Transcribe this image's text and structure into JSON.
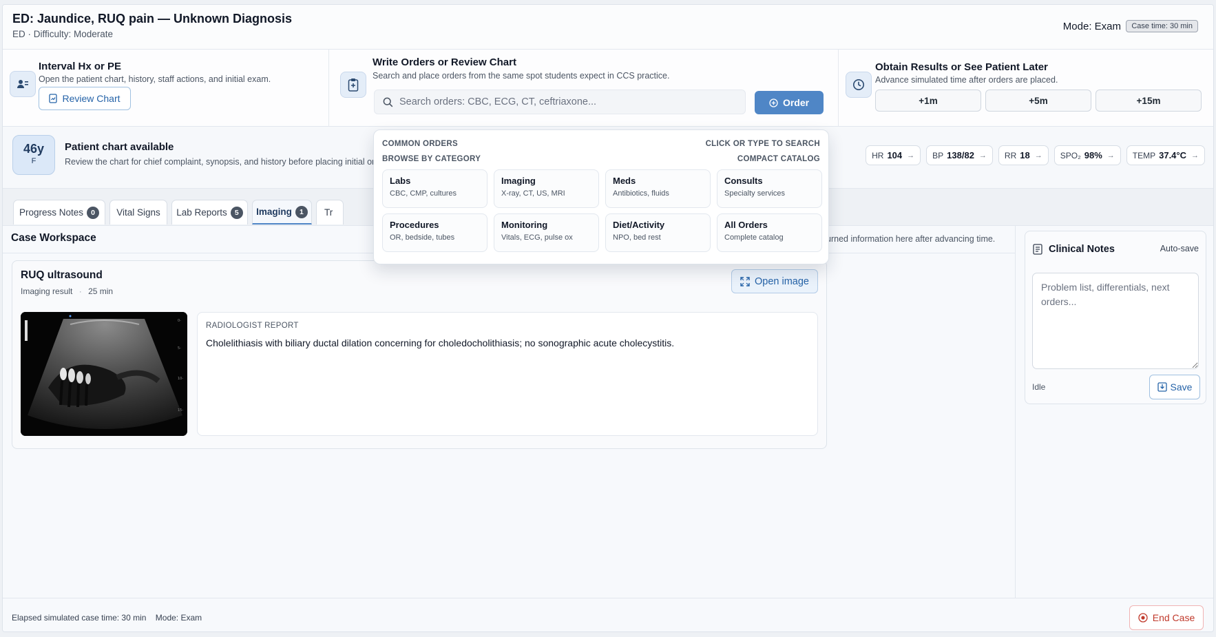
{
  "header": {
    "title": "ED: Jaundice, RUQ pain — Unknown Diagnosis",
    "subtitle": "ED · Difficulty: Moderate",
    "mode": "Mode: Exam",
    "case_time": "Case time: 30 min"
  },
  "actions": {
    "interval": {
      "title": "Interval Hx or PE",
      "desc": "Open the patient chart, history, staff actions, and initial exam.",
      "button": "Review Chart"
    },
    "orders": {
      "title": "Write Orders or Review Chart",
      "desc": "Search and place orders from the same spot students expect in CCS practice.",
      "search_placeholder": "Search orders: CBC, ECG, CT, ceftriaxone...",
      "button": "Order"
    },
    "results": {
      "title": "Obtain Results or See Patient Later",
      "desc": "Advance simulated time after orders are placed.",
      "buttons": [
        "+1m",
        "+5m",
        "+15m"
      ]
    }
  },
  "patient": {
    "age": "46y",
    "sex": "F",
    "title": "Patient chart available",
    "desc": "Review the chart for chief complaint, synopsis, and history before placing initial orders.",
    "vitals": [
      {
        "label": "HR",
        "value": "104"
      },
      {
        "label": "BP",
        "value": "138/82"
      },
      {
        "label": "RR",
        "value": "18"
      },
      {
        "label": "SPO₂",
        "value": "98%"
      },
      {
        "label": "TEMP",
        "value": "37.4°C"
      }
    ]
  },
  "tabs": [
    {
      "label": "Progress Notes",
      "badge": "0"
    },
    {
      "label": "Vital Signs",
      "badge": ""
    },
    {
      "label": "Lab Reports",
      "badge": "5"
    },
    {
      "label": "Imaging",
      "badge": "1"
    },
    {
      "label": "Tr",
      "badge": ""
    }
  ],
  "workspace": {
    "title": "Case Workspace",
    "hint": "urned information here after advancing time."
  },
  "result": {
    "title": "RUQ ultrasound",
    "type": "Imaging result",
    "time": "25 min",
    "open_button": "Open image",
    "report_label": "RADIOLOGIST REPORT",
    "report_text": "Cholelithiasis with biliary ductal dilation concerning for choledocholithiasis; no sonographic acute cholecystitis."
  },
  "notes": {
    "title": "Clinical Notes",
    "autosave": "Auto-save",
    "placeholder": "Problem list, differentials, next orders...",
    "status": "Idle",
    "save": "Save"
  },
  "footer": {
    "elapsed": "Elapsed simulated case time: 30 min",
    "mode": "Mode: Exam",
    "end_button": "End Case"
  },
  "dropdown": {
    "common_orders": "COMMON ORDERS",
    "click_hint": "CLICK OR TYPE TO SEARCH",
    "browse": "BROWSE BY CATEGORY",
    "compact": "COMPACT CATALOG",
    "categories": [
      {
        "name": "Labs",
        "desc": "CBC, CMP, cultures"
      },
      {
        "name": "Imaging",
        "desc": "X-ray, CT, US, MRI"
      },
      {
        "name": "Meds",
        "desc": "Antibiotics, fluids"
      },
      {
        "name": "Consults",
        "desc": "Specialty services"
      },
      {
        "name": "Procedures",
        "desc": "OR, bedside, tubes"
      },
      {
        "name": "Monitoring",
        "desc": "Vitals, ECG, pulse ox"
      },
      {
        "name": "Diet/Activity",
        "desc": "NPO, bed rest"
      },
      {
        "name": "All Orders",
        "desc": "Complete catalog"
      }
    ]
  },
  "colors": {
    "accent": "#4f86c6",
    "accent_text": "#2563a8",
    "danger": "#c0392b"
  }
}
